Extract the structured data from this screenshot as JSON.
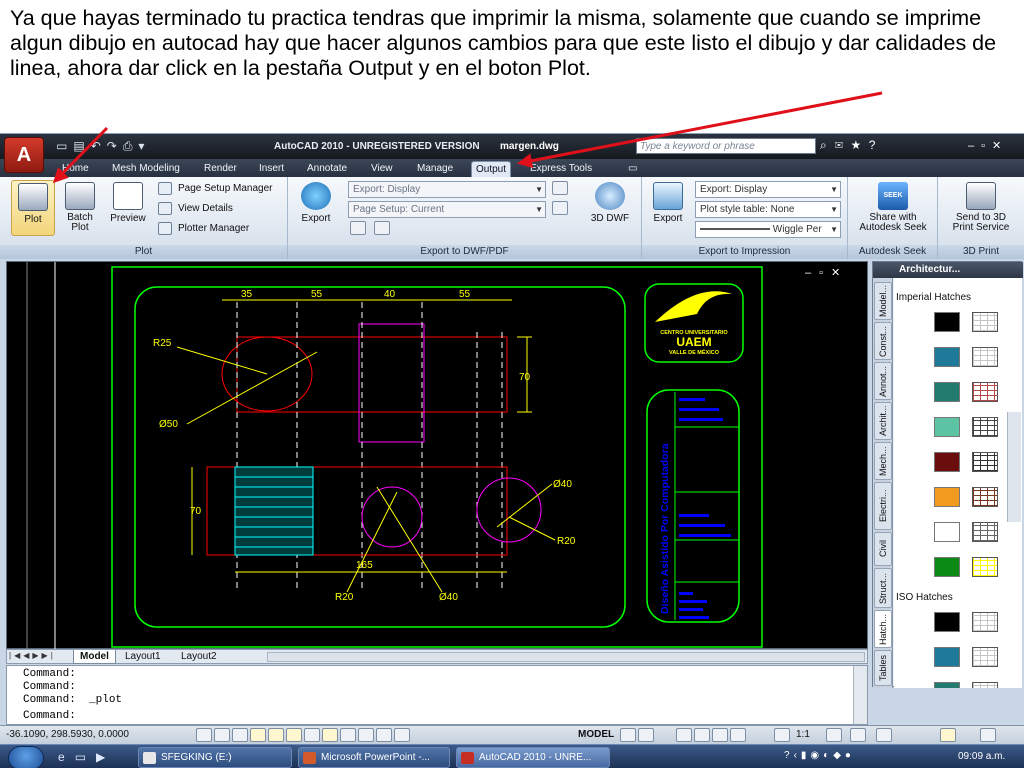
{
  "instruction": "Ya que hayas terminado tu practica tendras que imprimir la misma, solamente que cuando se imprime algun dibujo en autocad hay que hacer algunos cambios para que este listo el dibujo y dar calidades de linea, ahora dar click en la pestaña Output y en el boton Plot.",
  "window": {
    "app_button": "A",
    "title": "AutoCAD 2010 - UNREGISTERED VERSION",
    "filename": "margen.dwg",
    "search_placeholder": "Type a keyword or phrase"
  },
  "tabs": [
    {
      "label": "Home"
    },
    {
      "label": "Mesh Modeling"
    },
    {
      "label": "Render"
    },
    {
      "label": "Insert"
    },
    {
      "label": "Annotate"
    },
    {
      "label": "View"
    },
    {
      "label": "Manage"
    },
    {
      "label": "Output"
    },
    {
      "label": "Express Tools"
    }
  ],
  "ribbon": {
    "plot_panel": {
      "label": "Plot",
      "plot": "Plot",
      "batch_plot_1": "Batch",
      "batch_plot_2": "Plot",
      "preview": "Preview",
      "page_setup_manager": "Page Setup Manager",
      "view_details": "View Details",
      "plotter_manager": "Plotter Manager"
    },
    "dwf_panel": {
      "label": "Export to DWF/PDF",
      "export": "Export",
      "export_combo": "Export: Display",
      "page_setup_combo": "Page Setup: Current",
      "dwf3d": "3D DWF"
    },
    "impression_panel": {
      "label": "Export to Impression",
      "export": "Export",
      "export_combo": "Export: Display",
      "plot_style_combo": "Plot style table: None",
      "wiggle_combo": "Wiggle Per"
    },
    "seek_panel": {
      "label": "Autodesk Seek",
      "share_1": "Share with",
      "share_2": "Autodesk Seek",
      "seek_icon_text": "SEEK"
    },
    "print3d_panel": {
      "label": "3D Print",
      "send_1": "Send to 3D",
      "send_2": "Print Service"
    }
  },
  "drawing": {
    "dims": {
      "d35": "35",
      "d55a": "55",
      "d40": "40",
      "d55b": "55",
      "d70a": "70",
      "d70b": "70",
      "d165": "165",
      "r25": "R25",
      "d50": "Ø50",
      "d40a": "Ø40",
      "d40b": "Ø40",
      "r20a": "R20",
      "r20b": "R20"
    },
    "logo": {
      "line1": "CENTRO UNIVERSITARIO",
      "line2": "UAEM",
      "line3": "VALLE DE MÉXICO"
    },
    "title_block": {
      "vertical": "Diseño Asistido Por Computadora"
    }
  },
  "palette": {
    "title": "Architectur...",
    "tabs": [
      "Model...",
      "Const...",
      "Annot...",
      "Archit...",
      "Mech...",
      "Electri...",
      "Civil",
      "Struct...",
      "Hatch...",
      "Tables"
    ],
    "section1": "Imperial Hatches",
    "section2": "ISO Hatches",
    "imperial_swatches": [
      "#000000",
      "#1f7a99",
      "#237a6e",
      "#5cc4a3",
      "#6b0d0d",
      "#f29a1f",
      "#ffffff",
      "#0b8a16"
    ],
    "imperial_hatches": [
      "#c7c7c7",
      "#c7c7c7",
      "#b24a4a",
      "#444444",
      "#333333",
      "#7a3a22",
      "#666666",
      "#ffff00"
    ],
    "iso_swatches": [
      "#000000",
      "#1f7a99",
      "#237a6e"
    ]
  },
  "layout_tabs": [
    {
      "label": "Model"
    },
    {
      "label": "Layout1"
    },
    {
      "label": "Layout2"
    }
  ],
  "command_lines": [
    "Command:",
    "Command:",
    "Command:  _plot",
    "Command:"
  ],
  "status": {
    "coords": "-36.1090, 298.5930, 0.0000",
    "model": "MODEL",
    "scale": "1:1"
  },
  "taskbar": {
    "items": [
      "SFEGKING (E:)",
      "Microsoft PowerPoint -...",
      "AutoCAD 2010 - UNRE..."
    ],
    "clock": "09:09 a.m."
  },
  "colors": {
    "drawing_bg": "#000000",
    "border_green": "#00ff00",
    "dim_yellow": "#ffff00",
    "line_red": "#ff0000",
    "line_magenta": "#ff00ff",
    "hatch_cyan": "#00ffff",
    "block_blue": "#0000ff",
    "arrow_red": "#e0101a"
  }
}
